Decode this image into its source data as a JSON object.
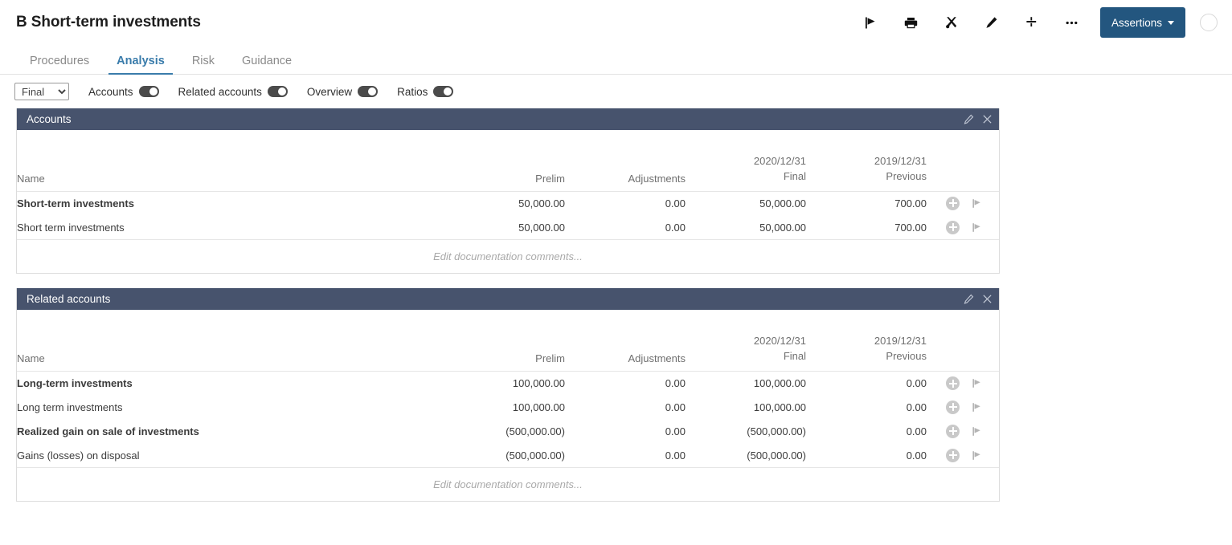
{
  "header": {
    "title": "B Short-term investments",
    "actions": [
      {
        "name": "flag-icon",
        "label": "Flag"
      },
      {
        "name": "print-icon",
        "label": "Print"
      },
      {
        "name": "tools-icon",
        "label": "Tools"
      },
      {
        "name": "pencil-icon",
        "label": "Edit"
      },
      {
        "name": "divide-icon",
        "label": "Divide"
      },
      {
        "name": "ellipsis-icon",
        "label": "More"
      }
    ],
    "assertions_label": "Assertions"
  },
  "tabs": [
    {
      "label": "Procedures",
      "active": false
    },
    {
      "label": "Analysis",
      "active": true
    },
    {
      "label": "Risk",
      "active": false
    },
    {
      "label": "Guidance",
      "active": false
    }
  ],
  "controls": {
    "period_select": {
      "value": "Final",
      "options": [
        "Final"
      ]
    },
    "toggles": [
      {
        "label": "Accounts",
        "on": true
      },
      {
        "label": "Related accounts",
        "on": true
      },
      {
        "label": "Overview",
        "on": true
      },
      {
        "label": "Ratios",
        "on": true
      }
    ]
  },
  "columns": {
    "name": "Name",
    "prelim": "Prelim",
    "adjustments": "Adjustments",
    "final_date": "2020/12/31",
    "final_label": "Final",
    "previous_date": "2019/12/31",
    "previous_label": "Previous"
  },
  "doc_comments_placeholder": "Edit documentation comments...",
  "panels": [
    {
      "title": "Accounts",
      "rows": [
        {
          "name": "Short-term investments",
          "type": "parent",
          "prelim": "50,000.00",
          "adjustments": "0.00",
          "final": "50,000.00",
          "previous": "700.00"
        },
        {
          "name": "Short term investments",
          "type": "child",
          "prelim": "50,000.00",
          "adjustments": "0.00",
          "final": "50,000.00",
          "previous": "700.00"
        }
      ]
    },
    {
      "title": "Related accounts",
      "rows": [
        {
          "name": "Long-term investments",
          "type": "parent",
          "prelim": "100,000.00",
          "adjustments": "0.00",
          "final": "100,000.00",
          "previous": "0.00"
        },
        {
          "name": "Long term investments",
          "type": "child",
          "prelim": "100,000.00",
          "adjustments": "0.00",
          "final": "100,000.00",
          "previous": "0.00"
        },
        {
          "name": "Realized gain on sale of investments",
          "type": "parent",
          "prelim": "(500,000.00)",
          "adjustments": "0.00",
          "final": "(500,000.00)",
          "previous": "0.00"
        },
        {
          "name": "Gains (losses) on disposal",
          "type": "child",
          "prelim": "(500,000.00)",
          "adjustments": "0.00",
          "final": "(500,000.00)",
          "previous": "0.00"
        }
      ]
    }
  ],
  "colors": {
    "accent": "#3a7cab",
    "panel_header": "#47536d",
    "button": "#23567f",
    "link": "#2f6ea5"
  }
}
